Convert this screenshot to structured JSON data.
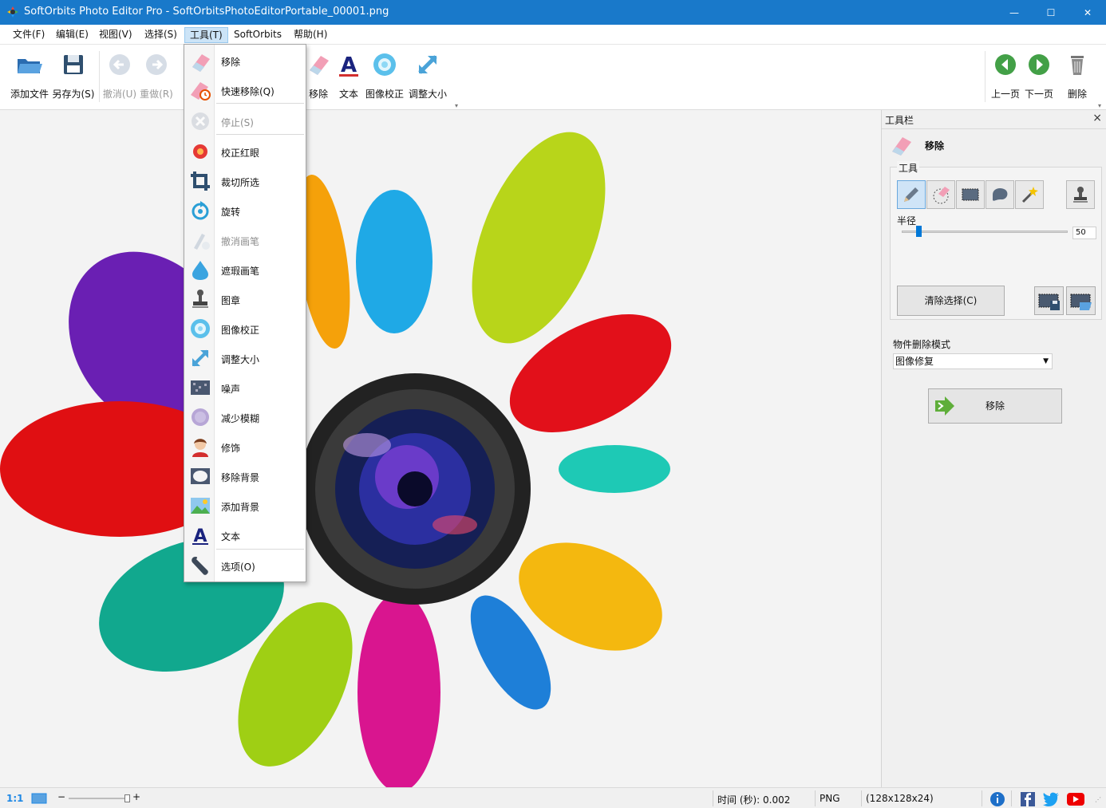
{
  "window": {
    "title": "SoftOrbits Photo Editor Pro - SoftOrbitsPhotoEditorPortable_00001.png",
    "buttons": {
      "minimize": "—",
      "maximize": "☐",
      "close": "✕"
    }
  },
  "menubar": {
    "items": [
      "文件(F)",
      "编辑(E)",
      "视图(V)",
      "选择(S)",
      "工具(T)",
      "SoftOrbits",
      "帮助(H)"
    ]
  },
  "toolbar": {
    "add_file": "添加文件",
    "save_as": "另存为(S)",
    "undo": "撤消(U)",
    "redo": "重做(R)",
    "remove": "移除",
    "text": "文本",
    "image_correction": "图像校正",
    "resize": "调整大小",
    "prev": "上一页",
    "next": "下一页",
    "delete": "删除"
  },
  "tools_menu": {
    "items": [
      {
        "label": "移除",
        "icon": "eraser-icon",
        "enabled": true
      },
      {
        "label": "快速移除(Q)",
        "icon": "quick-eraser-icon",
        "enabled": true
      },
      {
        "label": "停止(S)",
        "icon": "stop-icon",
        "enabled": false
      },
      {
        "label": "校正红眼",
        "icon": "red-eye-icon",
        "enabled": true
      },
      {
        "label": "裁切所选",
        "icon": "crop-icon",
        "enabled": true
      },
      {
        "label": "旋转",
        "icon": "rotate-icon",
        "enabled": true
      },
      {
        "label": "撤消画笔",
        "icon": "undo-brush-icon",
        "enabled": false
      },
      {
        "label": "遮瑕画笔",
        "icon": "concealer-brush-icon",
        "enabled": true
      },
      {
        "label": "图章",
        "icon": "stamp-icon",
        "enabled": true
      },
      {
        "label": "图像校正",
        "icon": "image-correction-icon",
        "enabled": true
      },
      {
        "label": "调整大小",
        "icon": "resize-icon",
        "enabled": true
      },
      {
        "label": "噪声",
        "icon": "noise-icon",
        "enabled": true
      },
      {
        "label": "减少模糊",
        "icon": "deblur-icon",
        "enabled": true
      },
      {
        "label": "修饰",
        "icon": "retouch-portrait-icon",
        "enabled": true
      },
      {
        "label": "移除背景",
        "icon": "remove-background-icon",
        "enabled": true
      },
      {
        "label": "添加背景",
        "icon": "add-background-icon",
        "enabled": true
      },
      {
        "label": "文本",
        "icon": "text-icon",
        "enabled": true
      },
      {
        "label": "选项(O)",
        "icon": "wrench-icon",
        "enabled": true
      }
    ]
  },
  "right_panel": {
    "header": "工具栏",
    "close": "×",
    "mode_title": "移除",
    "group_label": "工具",
    "radius_label": "半径",
    "radius_value": "50",
    "radius_min": 0,
    "radius_max": 500,
    "clear_selection": "清除选择(C)",
    "delete_mode_label": "物件删除模式",
    "delete_mode_value": "图像修复",
    "remove_button": "移除"
  },
  "statusbar": {
    "zoom_label": "1:1",
    "time": "时间 (秒): 0.002",
    "format": "PNG",
    "dimensions": "(128x128x24)",
    "zoom_minus": "−",
    "zoom_plus": "+"
  },
  "colors": {
    "titlebar": "#1979ca",
    "nav_green": "#4caf50",
    "accent_blue": "#1e88e5"
  }
}
